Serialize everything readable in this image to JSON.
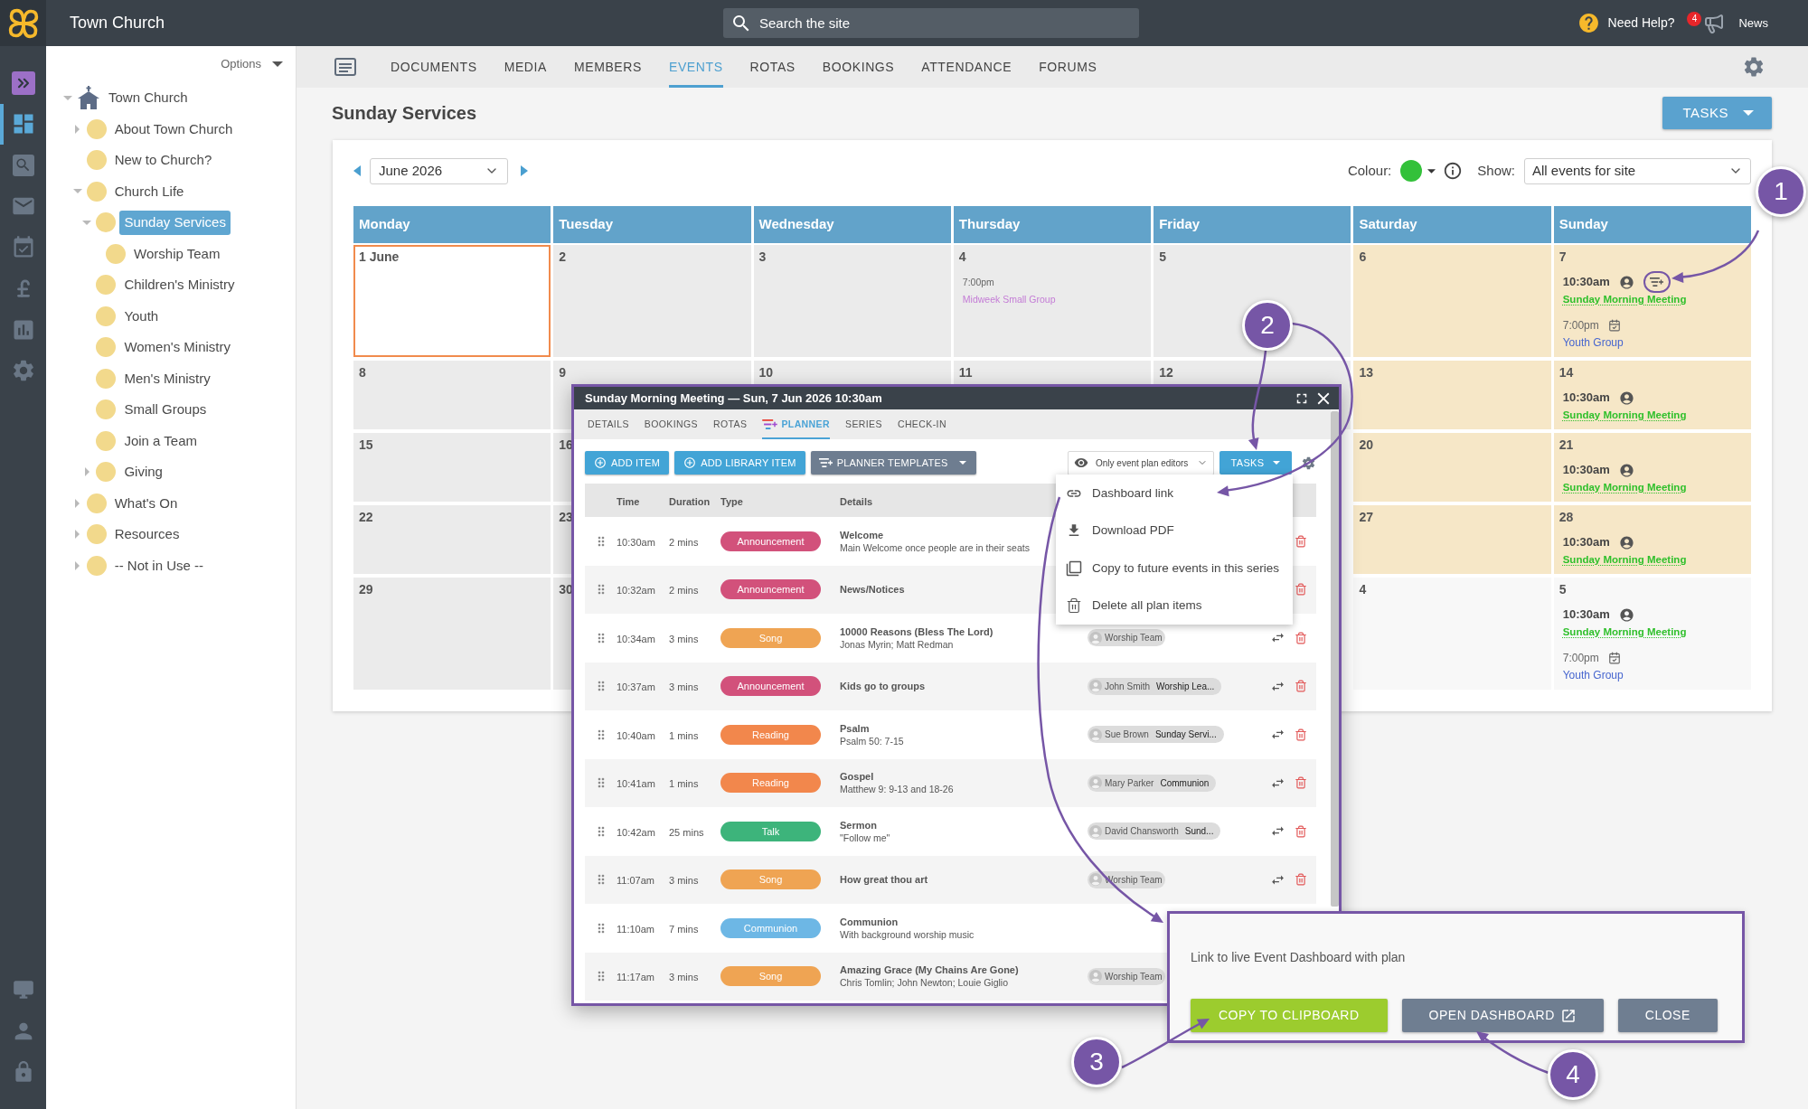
{
  "top_bar": {
    "site_name": "Town Church",
    "search": {
      "placeholder": "Search the site"
    },
    "help": "Need Help?",
    "notification_count": "4",
    "news": "News"
  },
  "rail": {
    "items": [
      {
        "kind": "expand",
        "selected": false
      },
      {
        "kind": "dashboard",
        "selected": true
      },
      {
        "kind": "search",
        "selected": false
      },
      {
        "kind": "mail",
        "selected": false
      },
      {
        "kind": "calendar",
        "selected": false
      },
      {
        "kind": "finance",
        "selected": false
      },
      {
        "kind": "reports",
        "selected": false
      },
      {
        "kind": "settings",
        "selected": false
      }
    ],
    "bottom_items": [
      {
        "kind": "display",
        "selected": false
      },
      {
        "kind": "account",
        "selected": false
      },
      {
        "kind": "lock",
        "selected": false
      }
    ]
  },
  "sidebar": {
    "options": "Options",
    "tree": [
      {
        "label": "Town Church",
        "kind": "home",
        "expanded": true,
        "selected": false,
        "children": [
          {
            "label": "About Town Church",
            "kind": "page",
            "expanded": false,
            "selected": false
          },
          {
            "label": "New to Church?",
            "kind": "page",
            "selected": false
          },
          {
            "label": "Church Life",
            "kind": "page",
            "expanded": true,
            "selected": false,
            "children": [
              {
                "label": "Sunday Services",
                "kind": "page",
                "expanded": true,
                "selected": true,
                "children": [
                  {
                    "label": "Worship Team",
                    "kind": "page",
                    "selected": false
                  }
                ]
              },
              {
                "label": "Children's Ministry",
                "kind": "page",
                "selected": false
              },
              {
                "label": "Youth",
                "kind": "page",
                "selected": false
              },
              {
                "label": "Women's Ministry",
                "kind": "page",
                "selected": false
              },
              {
                "label": "Men's Ministry",
                "kind": "page",
                "selected": false
              },
              {
                "label": "Small Groups",
                "kind": "page",
                "selected": false
              },
              {
                "label": "Join a Team",
                "kind": "page",
                "selected": false
              },
              {
                "label": "Giving",
                "kind": "page",
                "expanded": false,
                "selected": false
              }
            ]
          },
          {
            "label": "What's On",
            "kind": "page",
            "expanded": false,
            "selected": false
          },
          {
            "label": "Resources",
            "kind": "page",
            "expanded": false,
            "selected": false
          },
          {
            "label": "-- Not in Use --",
            "kind": "page",
            "expanded": false,
            "selected": false
          }
        ]
      }
    ]
  },
  "nav": {
    "tabs": [
      {
        "label": "DOCUMENTS",
        "selected": false
      },
      {
        "label": "MEDIA",
        "selected": false
      },
      {
        "label": "MEMBERS",
        "selected": false
      },
      {
        "label": "EVENTS",
        "selected": true
      },
      {
        "label": "ROTAS",
        "selected": false
      },
      {
        "label": "BOOKINGS",
        "selected": false
      },
      {
        "label": "ATTENDANCE",
        "selected": false
      },
      {
        "label": "FORUMS",
        "selected": false
      }
    ]
  },
  "page": {
    "title": "Sunday Services",
    "tasks_button": "TASKS"
  },
  "calendar": {
    "month": "June 2026",
    "colour_label": "Colour:",
    "show_label": "Show:",
    "show_value": "All events for site",
    "weekdays": [
      "Monday",
      "Tuesday",
      "Wednesday",
      "Thursday",
      "Friday",
      "Saturday",
      "Sunday"
    ],
    "weeks": [
      {
        "cells": [
          {
            "date": "1 June",
            "kind": "weekday",
            "today": true
          },
          {
            "date": "2",
            "kind": "weekday",
            "today": false
          },
          {
            "date": "3",
            "kind": "weekday",
            "today": false
          },
          {
            "date": "4",
            "kind": "weekday",
            "today": false,
            "events": [
              {
                "time": "7:00pm",
                "title": "Midweek Small Group",
                "kind": "plain",
                "color": "#c47cd6"
              }
            ]
          },
          {
            "date": "5",
            "kind": "weekday",
            "today": false
          },
          {
            "date": "6",
            "kind": "weekend",
            "today": false
          },
          {
            "date": "7",
            "kind": "weekend",
            "today": false,
            "events": [
              {
                "time": "10:30am",
                "title": "Sunday Morning Meeting",
                "kind": "rota_plan",
                "color": "#30c02c"
              },
              {
                "time": "7:00pm",
                "title": "Youth Group",
                "kind": "booking",
                "color": "#4766cf"
              }
            ]
          }
        ]
      },
      {
        "cells": [
          {
            "date": "8",
            "kind": "weekday",
            "today": false
          },
          {
            "date": "9",
            "kind": "weekday",
            "today": false
          },
          {
            "date": "10",
            "kind": "weekday",
            "today": false
          },
          {
            "date": "11",
            "kind": "weekday",
            "today": false
          },
          {
            "date": "12",
            "kind": "weekday",
            "today": false
          },
          {
            "date": "13",
            "kind": "weekend",
            "today": false
          },
          {
            "date": "14",
            "kind": "weekend",
            "today": false,
            "events": [
              {
                "time": "10:30am",
                "title": "Sunday Morning Meeting",
                "kind": "rota",
                "color": "#30c02c"
              }
            ]
          }
        ]
      },
      {
        "cells": [
          {
            "date": "15",
            "kind": "weekday",
            "today": false
          },
          {
            "date": "16",
            "kind": "weekday",
            "today": false
          },
          {},
          {},
          {},
          {
            "date": "20",
            "kind": "weekend",
            "today": false
          },
          {
            "date": "21",
            "kind": "weekend",
            "today": false,
            "events": [
              {
                "time": "10:30am",
                "title": "Sunday Morning Meeting",
                "kind": "rota",
                "color": "#30c02c"
              }
            ]
          }
        ]
      },
      {
        "cells": [
          {
            "date": "22",
            "kind": "weekday",
            "today": false
          },
          {
            "date": "23",
            "kind": "weekday",
            "today": false
          },
          {},
          {},
          {},
          {
            "date": "27",
            "kind": "weekend",
            "today": false
          },
          {
            "date": "28",
            "kind": "weekend",
            "today": false,
            "events": [
              {
                "time": "10:30am",
                "title": "Sunday Morning Meeting",
                "kind": "rota",
                "color": "#30c02c"
              }
            ]
          }
        ]
      },
      {
        "cells": [
          {
            "date": "29",
            "kind": "weekday",
            "today": false
          },
          {
            "date": "30",
            "kind": "weekday",
            "today": false
          },
          {},
          {},
          {},
          {
            "date": "4",
            "kind": "next_month",
            "today": false
          },
          {
            "date": "5",
            "kind": "next_month",
            "today": false,
            "events": [
              {
                "time": "10:30am",
                "title": "Sunday Morning Meeting",
                "kind": "rota",
                "color": "#30c02c"
              },
              {
                "time": "7:00pm",
                "title": "Youth Group",
                "kind": "booking",
                "color": "#4766cf"
              }
            ]
          }
        ]
      }
    ]
  },
  "event_modal": {
    "title": "Sunday Morning Meeting — Sun, 7 Jun 2026 10:30am",
    "tabs": [
      {
        "label": "DETAILS",
        "kind": "text",
        "selected": false
      },
      {
        "label": "BOOKINGS",
        "kind": "text",
        "selected": false
      },
      {
        "label": "ROTAS",
        "kind": "text",
        "selected": false
      },
      {
        "label": "PLANNER",
        "kind": "planner",
        "selected": true
      },
      {
        "label": "SERIES",
        "kind": "text",
        "selected": false
      },
      {
        "label": "CHECK-IN",
        "kind": "text",
        "selected": false
      }
    ],
    "toolbar_buttons": [
      {
        "label": "ADD ITEM",
        "kind": "add"
      },
      {
        "label": "ADD LIBRARY ITEM",
        "kind": "add"
      },
      {
        "label": "PLANNER TEMPLATES",
        "kind": "templates"
      }
    ],
    "visibility": "Only event plan editors",
    "tasks_button": "TASKS",
    "columns": [
      "Time",
      "Duration",
      "Type",
      "Details"
    ],
    "rows": [
      {
        "time": "10:30am",
        "duration": "2 mins",
        "type": "Announcement",
        "color": "#d2517b",
        "title": "Welcome",
        "subtitle": "Main Welcome once people are in their seats",
        "delete": true
      },
      {
        "time": "10:32am",
        "duration": "2 mins",
        "type": "Announcement",
        "color": "#d2517b",
        "title": "News/Notices",
        "delete": true
      },
      {
        "time": "10:34am",
        "duration": "3 mins",
        "type": "Song",
        "color": "#efa453",
        "title": "10000 Reasons (Bless The Lord)",
        "subtitle": "Jonas Myrin; Matt Redman",
        "assignees": [
          {
            "name": "Worship Team"
          }
        ],
        "swap": true,
        "delete": true
      },
      {
        "time": "10:37am",
        "duration": "3 mins",
        "type": "Announcement",
        "color": "#d2517b",
        "title": "Kids go to groups",
        "assignees": [
          {
            "name": "John Smith",
            "role": "Worship Lea..."
          }
        ],
        "swap": true,
        "delete": true
      },
      {
        "time": "10:40am",
        "duration": "1 mins",
        "type": "Reading",
        "color": "#f2874c",
        "title": "Psalm",
        "subtitle": "Psalm 50: 7-15",
        "assignees": [
          {
            "name": "Sue Brown",
            "role": "Sunday Servi..."
          }
        ],
        "swap": true,
        "delete": true
      },
      {
        "time": "10:41am",
        "duration": "1 mins",
        "type": "Reading",
        "color": "#f2874c",
        "title": "Gospel",
        "subtitle": "Matthew 9: 9-13 and 18-26",
        "assignees": [
          {
            "name": "Mary Parker",
            "role": "Communion"
          }
        ],
        "swap": true,
        "delete": true
      },
      {
        "time": "10:42am",
        "duration": "25 mins",
        "type": "Talk",
        "color": "#3db47b",
        "title": "Sermon",
        "subtitle": "\"Follow me\"",
        "assignees": [
          {
            "name": "David Chansworth",
            "role": "Sund..."
          }
        ],
        "swap": true,
        "delete": true
      },
      {
        "time": "11:07am",
        "duration": "3 mins",
        "type": "Song",
        "color": "#efa453",
        "title": "How great thou art",
        "assignees": [
          {
            "name": "Worship Team"
          }
        ],
        "swap": true,
        "delete": true
      },
      {
        "time": "11:10am",
        "duration": "7 mins",
        "type": "Communion",
        "color": "#6db7e5",
        "title": "Communion",
        "subtitle": "With background worship music"
      },
      {
        "time": "11:17am",
        "duration": "3 mins",
        "type": "Song",
        "color": "#efa453",
        "title": "Amazing Grace (My Chains Are Gone)",
        "subtitle": "Chris Tomlin; John Newton; Louie Giglio",
        "assignees": [
          {
            "name": "Worship Team"
          }
        ]
      }
    ]
  },
  "tasks_menu": {
    "items": [
      {
        "label": "Dashboard link",
        "kind": "link"
      },
      {
        "label": "Download PDF",
        "kind": "download"
      },
      {
        "label": "Copy to future events in this series",
        "kind": "copy"
      },
      {
        "label": "Delete all plan items",
        "kind": "delete"
      }
    ]
  },
  "link_dialog": {
    "text": "Link to live Event Dashboard with plan",
    "buttons": [
      {
        "label": "COPY TO CLIPBOARD",
        "kind": "primary"
      },
      {
        "label": "OPEN DASHBOARD",
        "kind": "external"
      },
      {
        "label": "CLOSE",
        "kind": "secondary"
      }
    ]
  },
  "callouts": [
    {
      "label": "1"
    },
    {
      "label": "2"
    },
    {
      "label": "3"
    },
    {
      "label": "4"
    }
  ]
}
